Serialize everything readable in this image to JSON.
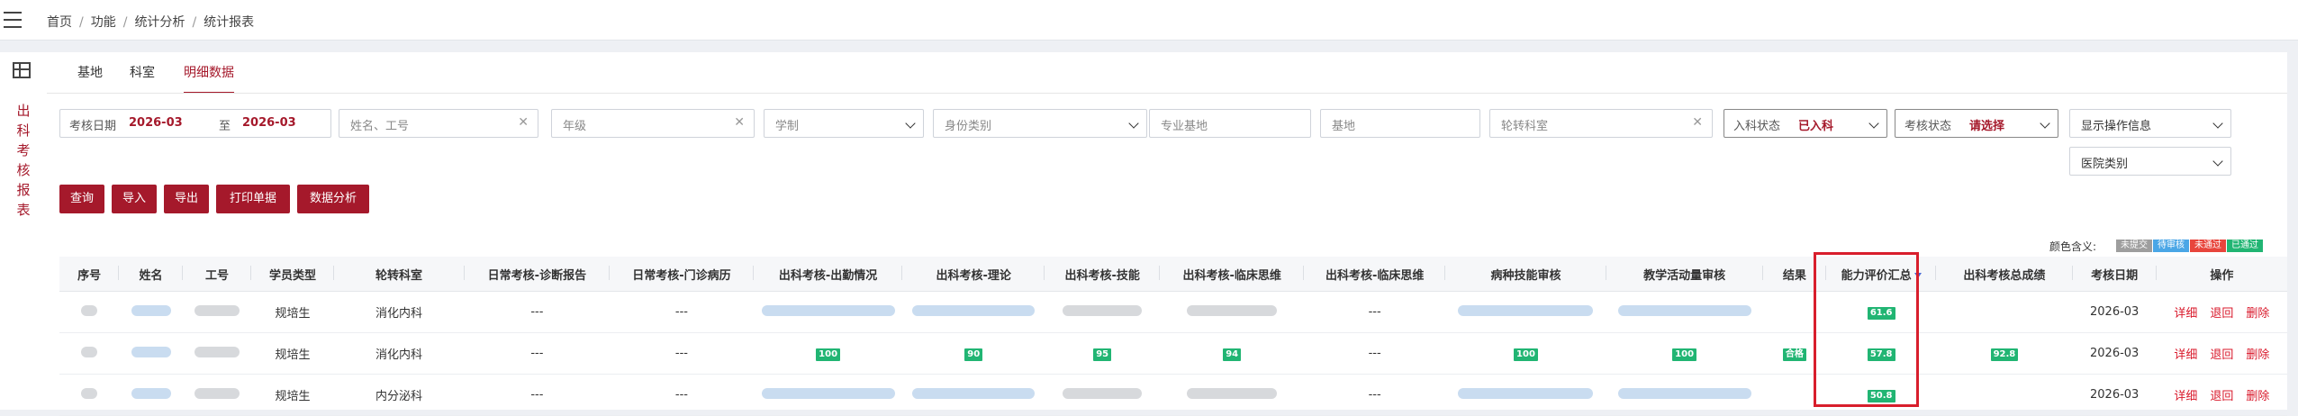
{
  "breadcrumb": [
    "首页",
    "功能",
    "统计分析",
    "统计报表"
  ],
  "tabs": [
    {
      "label": "基地"
    },
    {
      "label": "科室"
    },
    {
      "label": "明细数据",
      "active": true
    }
  ],
  "sidebar_title": [
    "出",
    "科",
    "考",
    "核",
    "报",
    "表"
  ],
  "filters": {
    "date_label": "考核日期",
    "date_from": "2026-03",
    "date_to_sep": "至",
    "date_to": "2026-03",
    "name_placeholder": "姓名、工号",
    "grade_placeholder": "年级",
    "system_placeholder": "学制",
    "identity_placeholder": "身份类别",
    "major_base_placeholder": "专业基地",
    "base_placeholder": "基地",
    "rotation_placeholder": "轮转科室",
    "enroll_label": "入科状态",
    "enroll_value": "已入科",
    "assess_label": "考核状态",
    "assess_value": "请选择",
    "show_op_placeholder": "显示操作信息",
    "hospital_placeholder": "医院类别"
  },
  "buttons": [
    "查询",
    "导入",
    "导出",
    "打印单据",
    "数据分析"
  ],
  "legend": {
    "label": "颜色含义:",
    "items": [
      {
        "text": "未提交",
        "color": "#9e9e9e"
      },
      {
        "text": "待审核",
        "color": "#4aa6e6"
      },
      {
        "text": "未通过",
        "color": "#e8453c"
      },
      {
        "text": "已通过",
        "color": "#21b573"
      }
    ]
  },
  "table": {
    "columns": [
      "序号",
      "姓名",
      "工号",
      "学员类型",
      "轮转科室",
      "日常考核-诊断报告",
      "日常考核-门诊病历",
      "出科考核-出勤情况",
      "出科考核-理论",
      "出科考核-技能",
      "出科考核-临床思维",
      "出科考核-临床思维",
      "病种技能审核",
      "教学活动量审核",
      "结果",
      "能力评价汇总",
      "出科考核总成绩",
      "考核日期",
      "操作"
    ],
    "actions": [
      "详细",
      "退回",
      "删除"
    ],
    "rows": [
      {
        "type": "规培生",
        "dept": "消化内科",
        "diag": "---",
        "outp": "---",
        "attend": "",
        "theory": "",
        "skill": "",
        "think1": "",
        "think2": "---",
        "disease": "",
        "teach": "",
        "result": "",
        "ability": "61.6",
        "total": "",
        "date": "2026-03"
      },
      {
        "type": "规培生",
        "dept": "消化内科",
        "diag": "---",
        "outp": "---",
        "attend": "100",
        "theory": "90",
        "skill": "95",
        "think1": "94",
        "think2": "---",
        "disease": "100",
        "teach": "100",
        "result": "合格",
        "ability": "57.8",
        "total": "92.8",
        "date": "2026-03"
      },
      {
        "type": "规培生",
        "dept": "内分泌科",
        "diag": "---",
        "outp": "---",
        "attend": "",
        "theory": "",
        "skill": "",
        "think1": "",
        "think2": "---",
        "disease": "",
        "teach": "",
        "result": "",
        "ability": "50.8",
        "total": "",
        "date": "2026-03"
      }
    ]
  }
}
